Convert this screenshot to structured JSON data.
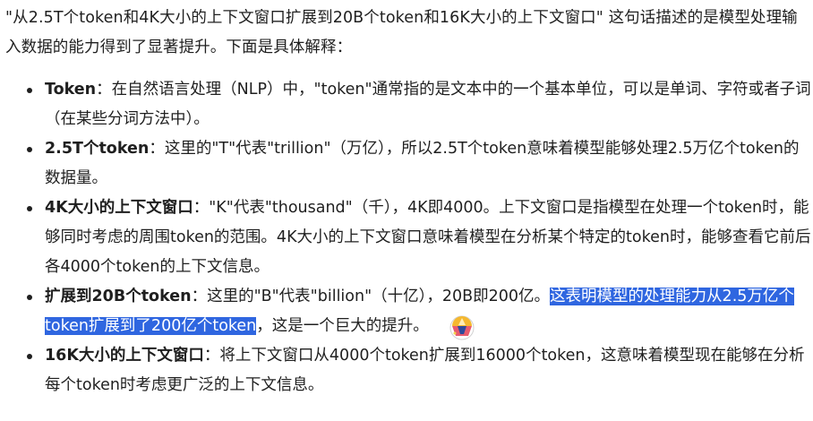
{
  "intro": "\"从2.5T个token和4K大小的上下文窗口扩展到20B个token和16K大小的上下文窗口\" 这句话描述的是模型处理输入数据的能力得到了显著提升。下面是具体解释：",
  "items": [
    {
      "term": "Token",
      "desc": "：在自然语言处理（NLP）中，\"token\"通常指的是文本中的一个基本单位，可以是单词、字符或者子词（在某些分词方法中）。"
    },
    {
      "term": "2.5T个token",
      "desc": "：这里的\"T\"代表\"trillion\"（万亿），所以2.5T个token意味着模型能够处理2.5万亿个token的数据量。"
    },
    {
      "term": "4K大小的上下文窗口",
      "desc": "：\"K\"代表\"thousand\"（千），4K即4000。上下文窗口是指模型在处理一个token时，能够同时考虑的周围token的范围。4K大小的上下文窗口意味着模型在分析某个特定的token时，能够查看它前后各4000个token的上下文信息。"
    },
    {
      "term": "扩展到20B个token",
      "desc": "：这里的\"B\"代表\"billion\"（十亿），20B即200亿。",
      "highlight": "这表明模型的处理能力从2.5万亿个token扩展到了200亿个token",
      "tail": "，这是一个巨大的提升。"
    },
    {
      "term": "16K大小的上下文窗口",
      "desc": "：将上下文窗口从4000个token扩展到16000个token，这意味着模型现在能够在分析每个token时考虑更广泛的上下文信息。"
    }
  ],
  "overlay_icon": "round-emoji-badge-icon",
  "colors": {
    "text": "#1f1f1f",
    "selection": "#2f66e0",
    "selection_text": "#ffffff"
  }
}
